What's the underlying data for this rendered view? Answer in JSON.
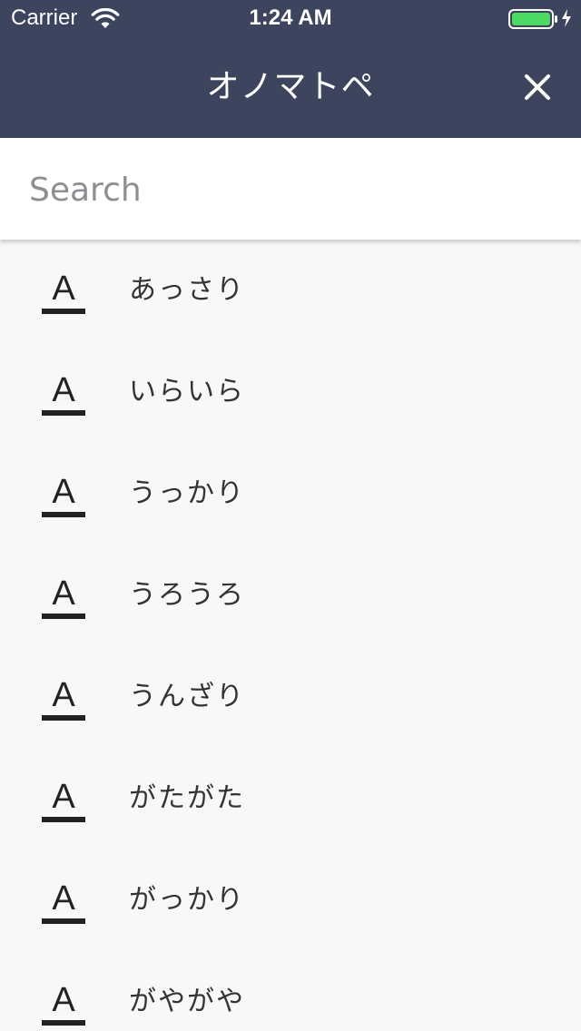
{
  "status_bar": {
    "carrier": "Carrier",
    "time": "1:24 AM",
    "wifi_icon": "wifi-icon",
    "battery_icon": "battery-icon",
    "battery_color": "#4cd964"
  },
  "header": {
    "title": "オノマトペ",
    "close_icon": "close-icon",
    "background": "#3d445e"
  },
  "search": {
    "placeholder": "Search",
    "value": ""
  },
  "list": {
    "icon": "font-icon",
    "icon_letter": "A",
    "items": [
      {
        "label": "あっさり"
      },
      {
        "label": "いらいら"
      },
      {
        "label": "うっかり"
      },
      {
        "label": "うろうろ"
      },
      {
        "label": "うんざり"
      },
      {
        "label": "がたがた"
      },
      {
        "label": "がっかり"
      },
      {
        "label": "がやがや"
      }
    ]
  }
}
